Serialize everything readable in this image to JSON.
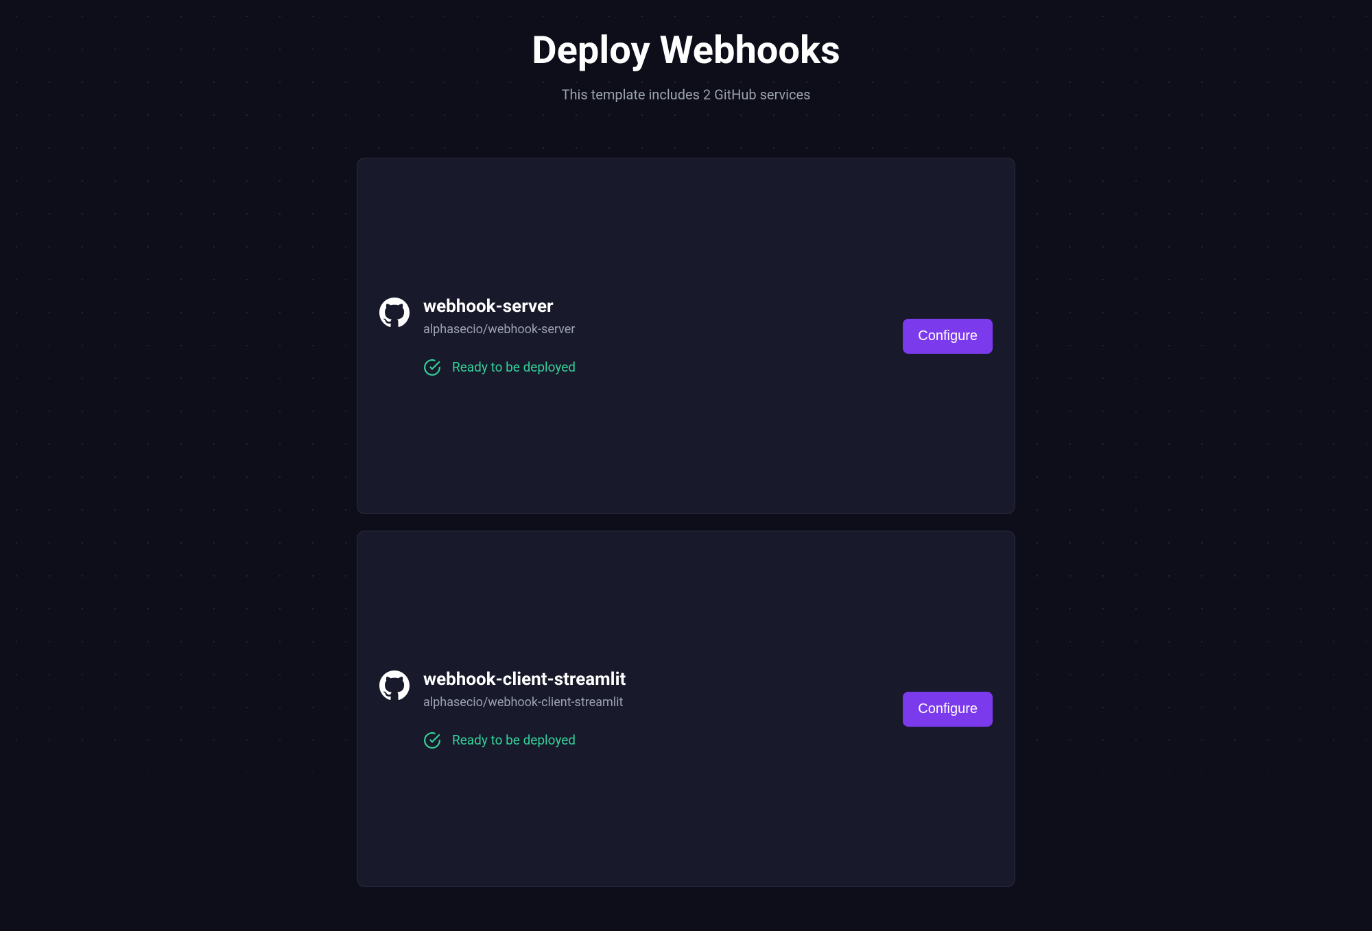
{
  "page": {
    "title": "Deploy Webhooks",
    "subtitle": "This template includes 2 GitHub services"
  },
  "services": [
    {
      "name": "webhook-server",
      "repo": "alphasecio/webhook-server",
      "status": "Ready to be deployed",
      "action": "Configure"
    },
    {
      "name": "webhook-client-streamlit",
      "repo": "alphasecio/webhook-client-streamlit",
      "status": "Ready to be deployed",
      "action": "Configure"
    }
  ],
  "colors": {
    "background": "#0d0e1a",
    "cardBackground": "#18192b",
    "border": "#2a2d3f",
    "accent": "#7c3aed",
    "success": "#34d399",
    "muted": "#9ca3af"
  }
}
